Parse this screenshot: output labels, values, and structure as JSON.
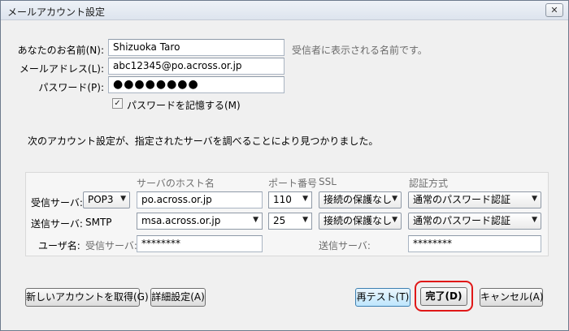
{
  "window": {
    "title": "メールアカウント設定",
    "close_glyph": "✕"
  },
  "identity": {
    "name_label": "あなたのお名前(N):",
    "name_value": "Shizuoka Taro",
    "name_hint": "受信者に表示される名前です。",
    "email_label": "メールアドレス(L):",
    "email_value": "abc12345@po.across.or.jp",
    "password_label": "パスワード(P):",
    "password_value": "●●●●●●●●",
    "remember_label": "パスワードを記憶する(M)",
    "remember_checked": true,
    "remember_glyph": "✓"
  },
  "message": "次のアカウント設定が、指定されたサーバを調べることにより見つかりました。",
  "server_table": {
    "headers": {
      "host": "サーバのホスト名",
      "port": "ポート番号",
      "ssl": "SSL",
      "auth": "認証方式"
    },
    "incoming": {
      "label": "受信サーバ:",
      "protocol": "POP3",
      "host": "po.across.or.jp",
      "port": "110",
      "ssl": "接続の保護なし",
      "auth": "通常のパスワード認証"
    },
    "outgoing": {
      "label": "送信サーバ:",
      "protocol": "SMTP",
      "host": "msa.across.or.jp",
      "port": "25",
      "ssl": "接続の保護なし",
      "auth": "通常のパスワード認証"
    },
    "username": {
      "label": "ユーザ名:",
      "incoming_label": "受信サーバ:",
      "incoming_value": "********",
      "outgoing_label": "送信サーバ:",
      "outgoing_value": "********"
    },
    "dropdown_glyph": "▼"
  },
  "buttons": {
    "new_account": "新しいアカウントを取得(G)",
    "advanced": "詳細設定(A)",
    "retest": "再テスト(T)",
    "done": "完了(D)",
    "cancel": "キャンセル(A)"
  },
  "colors": {
    "highlight_ring": "#e01818",
    "accent_button": "#bee6fd"
  }
}
